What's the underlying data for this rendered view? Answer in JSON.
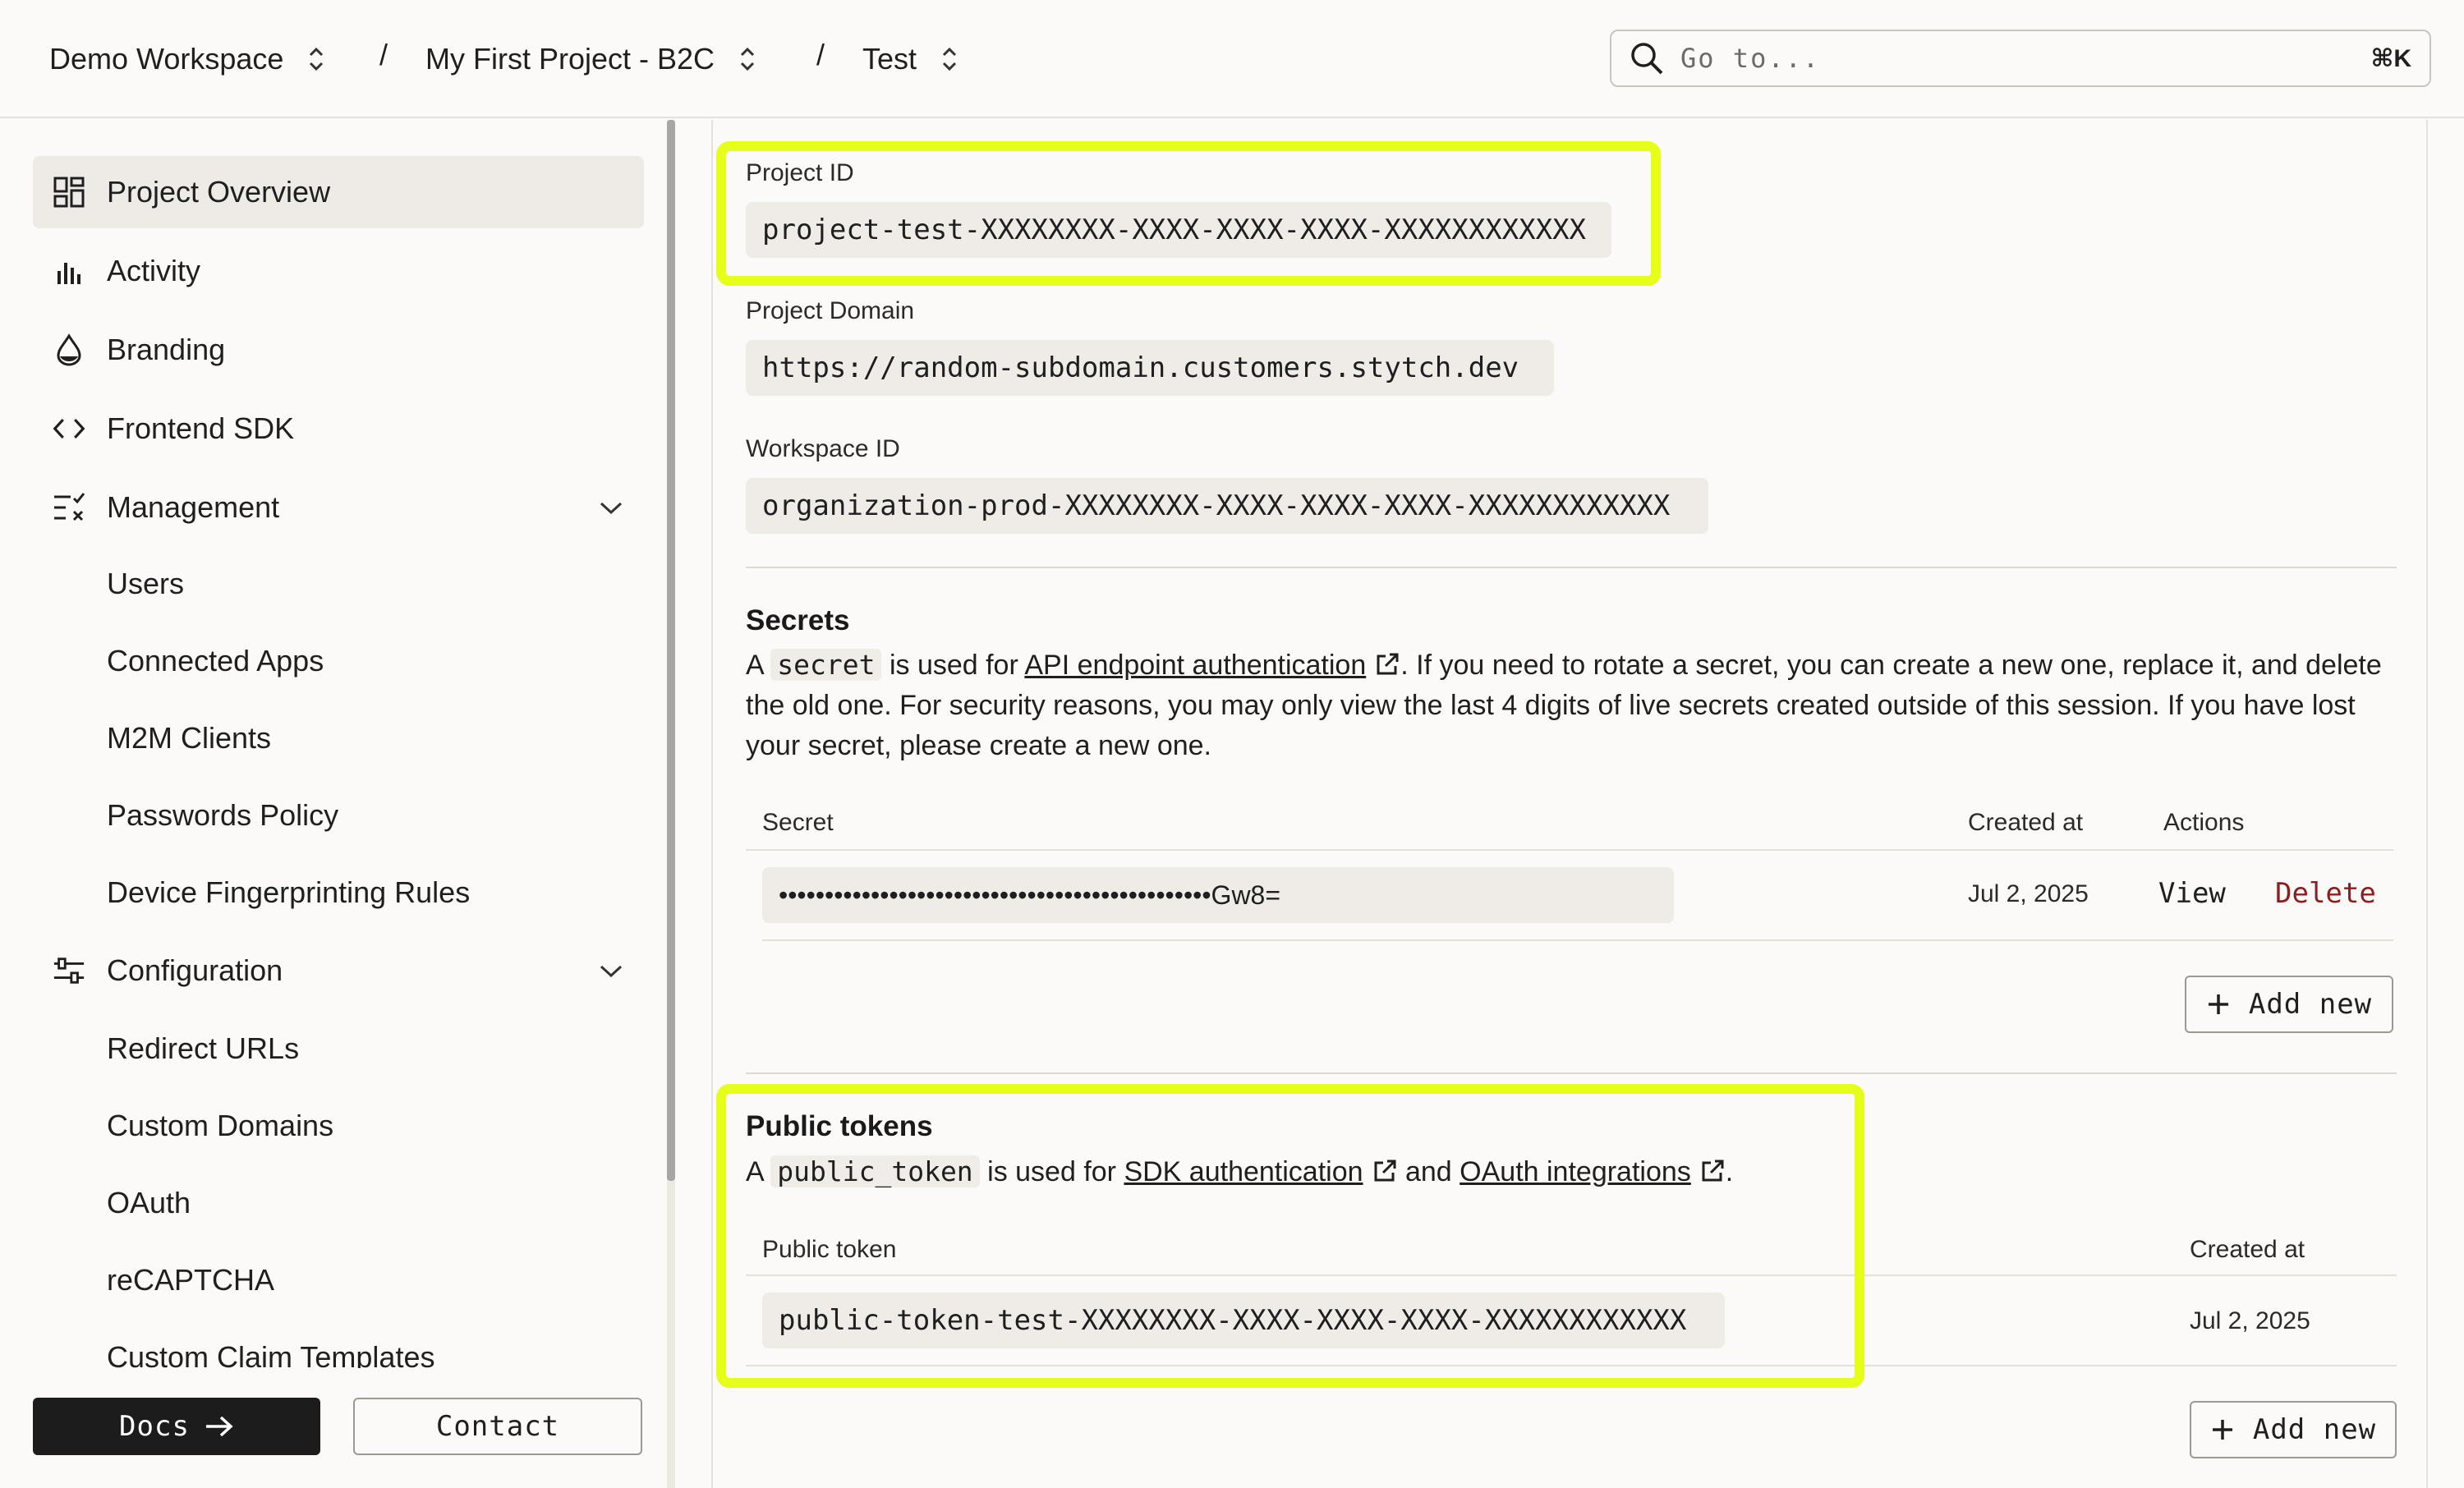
{
  "header": {
    "workspace": "Demo Workspace",
    "project": "My First Project - B2C",
    "environment": "Test",
    "separator": "/",
    "search": {
      "placeholder": "Go to...",
      "shortcut": "⌘K"
    }
  },
  "sidebar": {
    "items": [
      {
        "label": "Project Overview",
        "icon": "grid-icon",
        "active": true
      },
      {
        "label": "Activity",
        "icon": "bar-chart-icon"
      },
      {
        "label": "Branding",
        "icon": "drop-icon"
      },
      {
        "label": "Frontend SDK",
        "icon": "code-icon"
      },
      {
        "label": "Management",
        "icon": "management-icon",
        "expanded": true
      },
      {
        "label": "Configuration",
        "icon": "sliders-icon",
        "expanded": true
      }
    ],
    "management_sub": [
      "Users",
      "Connected Apps",
      "M2M Clients",
      "Passwords Policy",
      "Device Fingerprinting Rules"
    ],
    "configuration_sub": [
      "Redirect URLs",
      "Custom Domains",
      "OAuth",
      "reCAPTCHA",
      "Custom Claim Templates"
    ],
    "docs_label": "Docs",
    "contact_label": "Contact"
  },
  "project": {
    "id_label": "Project ID",
    "id_value": "project-test-XXXXXXXX-XXXX-XXXX-XXXX-XXXXXXXXXXXX",
    "domain_label": "Project Domain",
    "domain_value": "https://random-subdomain.customers.stytch.dev",
    "workspace_label": "Workspace ID",
    "workspace_value": "organization-prod-XXXXXXXX-XXXX-XXXX-XXXX-XXXXXXXXXXXX"
  },
  "secrets": {
    "title": "Secrets",
    "desc_a": "A",
    "desc_code": "secret",
    "desc_b": "is used for",
    "desc_link": "API endpoint authentication",
    "desc_c": ". If you need to rotate a secret, you can create a new one, replace it, and delete the old one. For security reasons, you may only view the last 4 digits of live secrets created outside of this session. If you have lost your secret, please create a new one.",
    "col_secret": "Secret",
    "col_created": "Created at",
    "col_actions": "Actions",
    "row": {
      "secret": "•••••••••••••••••••••••••••••••••••••••••••••••Gw8=",
      "created": "Jul 2, 2025",
      "view": "View",
      "delete": "Delete"
    },
    "add_new": "Add new"
  },
  "public_tokens": {
    "title": "Public tokens",
    "desc_a": "A",
    "desc_code": "public_token",
    "desc_b": "is used for",
    "link1": "SDK authentication",
    "desc_and": "and",
    "link2": "OAuth integrations",
    "desc_end": ".",
    "col_token": "Public token",
    "col_created": "Created at",
    "row": {
      "token": "public-token-test-XXXXXXXX-XXXX-XXXX-XXXX-XXXXXXXXXXXX",
      "created": "Jul 2, 2025"
    },
    "add_new": "Add new"
  },
  "colors": {
    "highlight": "#e6ff1a",
    "delete": "#8b1f1f",
    "code_bg": "#efebe7"
  }
}
